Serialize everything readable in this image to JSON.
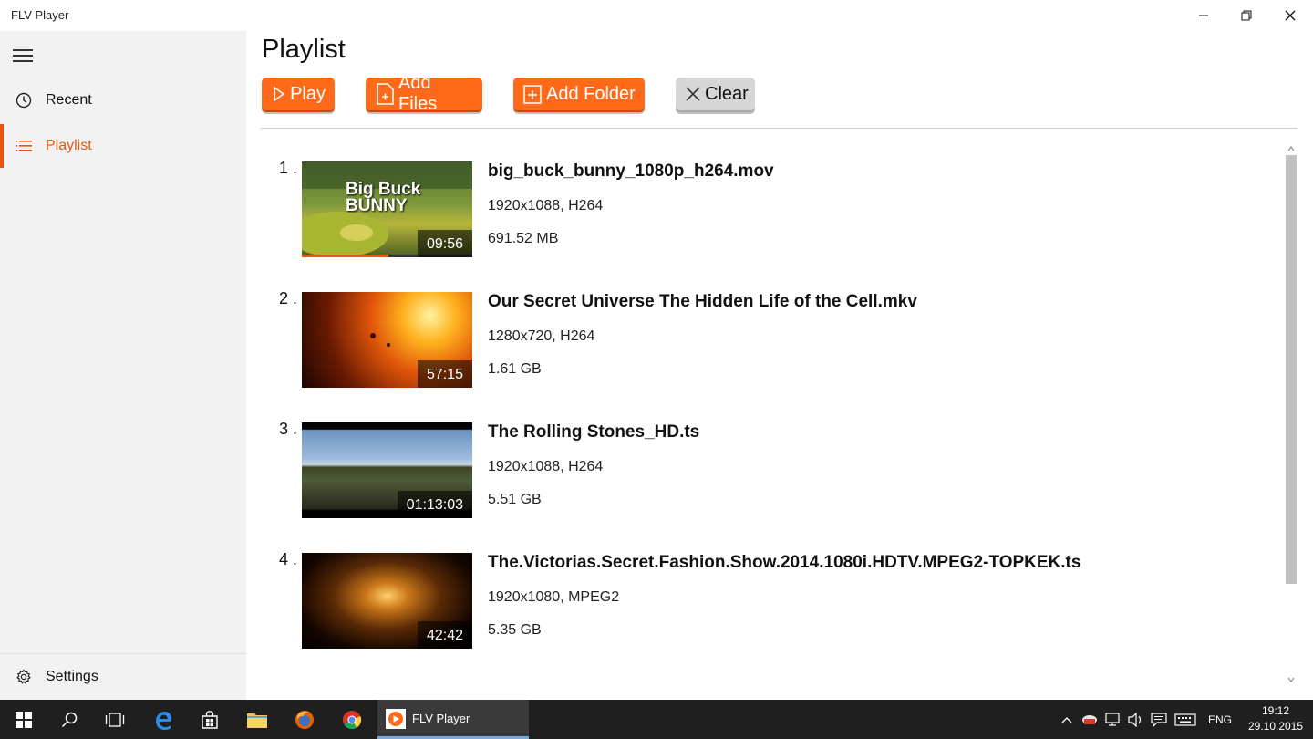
{
  "window": {
    "title": "FLV Player"
  },
  "sidebar": {
    "items": [
      {
        "label": "Recent",
        "icon": "clock-icon"
      },
      {
        "label": "Playlist",
        "icon": "list-icon"
      }
    ],
    "settings_label": "Settings"
  },
  "main": {
    "title": "Playlist",
    "toolbar": {
      "play_label": "Play",
      "add_files_label": "Add Files",
      "add_folder_label": "Add Folder",
      "clear_label": "Clear"
    },
    "playlist": [
      {
        "num": "1 .",
        "name": "big_buck_bunny_1080p_h264.mov",
        "resolution": "1920x1088, H264",
        "size": "691.52 MB",
        "duration": "09:56",
        "thumb_text": "Big Buck BUNNY",
        "progress": 0.51
      },
      {
        "num": "2 .",
        "name": "Our Secret Universe The Hidden Life of the Cell.mkv",
        "resolution": "1280x720, H264",
        "size": "1.61 GB",
        "duration": "57:15"
      },
      {
        "num": "3 .",
        "name": "The Rolling Stones_HD.ts",
        "resolution": "1920x1088, H264",
        "size": "5.51 GB",
        "duration": "01:13:03"
      },
      {
        "num": "4 .",
        "name": "The.Victorias.Secret.Fashion.Show.2014.1080i.HDTV.MPEG2-TOPKEK.ts",
        "resolution": "1920x1080, MPEG2",
        "size": "5.35 GB",
        "duration": "42:42"
      }
    ]
  },
  "taskbar": {
    "app_label": "FLV Player",
    "language": "ENG",
    "time": "19:12",
    "date": "29.10.2015"
  },
  "colors": {
    "accent": "#e8570c",
    "button_orange": "#ff6a1a",
    "sidebar_bg": "#f2f2f2",
    "taskbar_bg": "#1f1f1f"
  }
}
